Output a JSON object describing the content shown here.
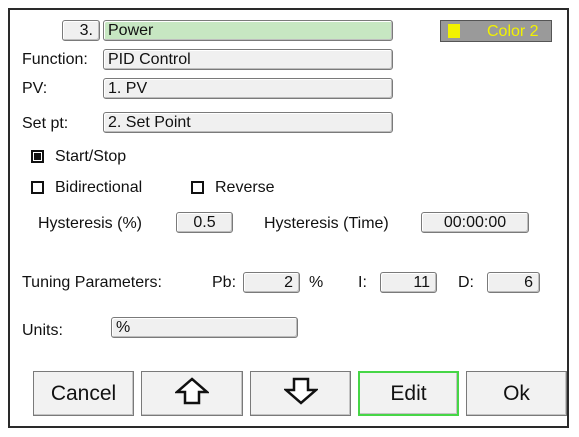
{
  "output": {
    "number": "3.",
    "name": "Power"
  },
  "color": {
    "label": "Color 2",
    "swatch": "#f2f200",
    "background": "#9a9a9a"
  },
  "function": {
    "label": "Function:",
    "value": "PID Control"
  },
  "pv": {
    "label": "PV:",
    "value": "1. PV"
  },
  "setpoint": {
    "label": "Set pt:",
    "value": "2. Set Point"
  },
  "start_stop": {
    "label": "Start/Stop",
    "checked": true
  },
  "bidirectional": {
    "label": "Bidirectional",
    "checked": false
  },
  "reverse": {
    "label": "Reverse",
    "checked": false
  },
  "hysteresis_pct": {
    "label": "Hysteresis (%)",
    "value": "0.5"
  },
  "hysteresis_time": {
    "label": "Hysteresis (Time)",
    "value": "00:00:00"
  },
  "tuning": {
    "label": "Tuning Parameters:",
    "pb_label": "Pb:",
    "pb_value": "2",
    "pb_unit": "%",
    "i_label": "I:",
    "i_value": "11",
    "d_label": "D:",
    "d_value": "6"
  },
  "units": {
    "label": "Units:",
    "value": "%"
  },
  "buttons": {
    "cancel": "Cancel",
    "up_icon": "up-arrow-icon",
    "down_icon": "down-arrow-icon",
    "edit": "Edit",
    "ok": "Ok"
  },
  "accent": "#47d647"
}
